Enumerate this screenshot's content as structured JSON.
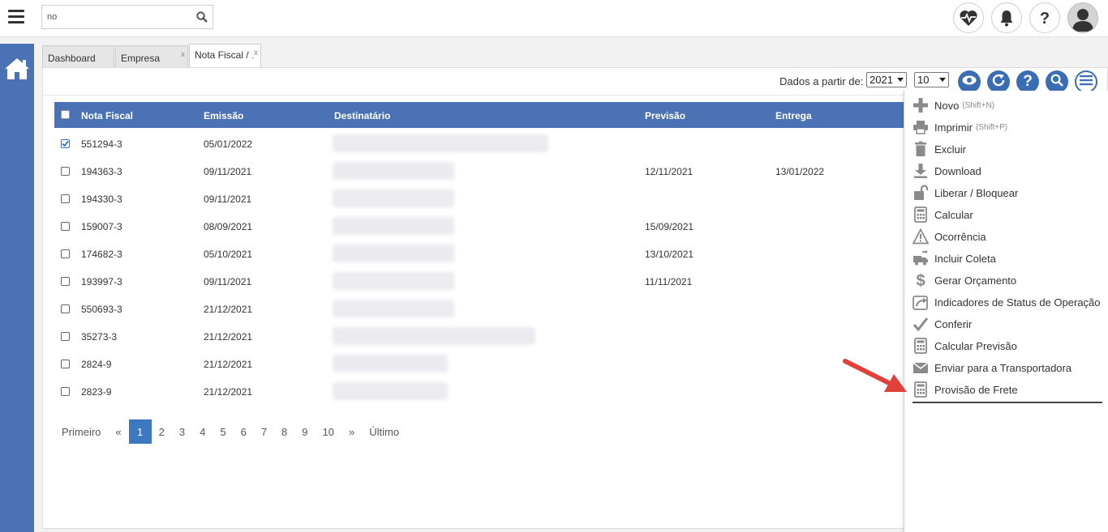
{
  "search": {
    "value": "no",
    "icon": "search-icon"
  },
  "tabs": [
    {
      "label": "Dashboard"
    },
    {
      "label": "Empresa",
      "close": "x"
    },
    {
      "label": "Nota Fiscal / I",
      "close": "x"
    }
  ],
  "toolbar": {
    "dados_label": "Dados a partir de:",
    "year": "2021",
    "page_size": "10"
  },
  "table": {
    "columns": [
      "Nota Fiscal",
      "Emissão",
      "Destinatário",
      "Previsão",
      "Entrega"
    ],
    "rows": [
      {
        "nf": "551294-3",
        "emissao": "05/01/2022",
        "previsao": "",
        "entrega": "",
        "checked": true
      },
      {
        "nf": "194363-3",
        "emissao": "09/11/2021",
        "previsao": "12/11/2021",
        "entrega": "13/01/2022",
        "checked": false
      },
      {
        "nf": "194330-3",
        "emissao": "09/11/2021",
        "previsao": "",
        "entrega": "",
        "checked": false
      },
      {
        "nf": "159007-3",
        "emissao": "08/09/2021",
        "previsao": "15/09/2021",
        "entrega": "",
        "checked": false
      },
      {
        "nf": "174682-3",
        "emissao": "05/10/2021",
        "previsao": "13/10/2021",
        "entrega": "",
        "checked": false
      },
      {
        "nf": "193997-3",
        "emissao": "09/11/2021",
        "previsao": "11/11/2021",
        "entrega": "",
        "checked": false
      },
      {
        "nf": "550693-3",
        "emissao": "21/12/2021",
        "previsao": "",
        "entrega": "",
        "checked": false
      },
      {
        "nf": "35273-3",
        "emissao": "21/12/2021",
        "previsao": "",
        "entrega": "",
        "checked": false
      },
      {
        "nf": "2824-9",
        "emissao": "21/12/2021",
        "previsao": "",
        "entrega": "",
        "checked": false
      },
      {
        "nf": "2823-9",
        "emissao": "21/12/2021",
        "previsao": "",
        "entrega": "",
        "checked": false
      }
    ]
  },
  "pager": {
    "first": "Primeiro",
    "prev": "«",
    "pages": [
      "1",
      "2",
      "3",
      "4",
      "5",
      "6",
      "7",
      "8",
      "9",
      "10"
    ],
    "current": "1",
    "next": "»",
    "last": "Último"
  },
  "menu": {
    "items": [
      {
        "label": "Novo",
        "shortcut": "(Shift+N)",
        "icon": "plus-icon"
      },
      {
        "label": "Imprimir",
        "shortcut": "(Shift+P)",
        "icon": "printer-icon"
      },
      {
        "label": "Excluir",
        "icon": "trash-icon"
      },
      {
        "label": "Download",
        "icon": "download-icon"
      },
      {
        "label": "Liberar / Bloquear",
        "icon": "unlock-icon"
      },
      {
        "label": "Calcular",
        "icon": "calculator-icon"
      },
      {
        "label": "Ocorrência",
        "icon": "warning-icon"
      },
      {
        "label": "Incluir Coleta",
        "icon": "truck-icon"
      },
      {
        "label": "Gerar Orçamento",
        "icon": "dollar-icon"
      },
      {
        "label": "Indicadores de Status de Operação",
        "icon": "share-icon"
      },
      {
        "label": "Conferir",
        "icon": "check-icon"
      },
      {
        "label": "Calcular Previsão",
        "icon": "calculator-icon"
      },
      {
        "label": "Enviar para a Transportadora",
        "icon": "envelope-icon"
      },
      {
        "label": "Provisão de Frete",
        "icon": "calculator-icon"
      }
    ]
  },
  "colors": {
    "primary": "#4a72b4",
    "button_blue": "#3b6db5",
    "annotation_arrow": "#e0413a"
  }
}
